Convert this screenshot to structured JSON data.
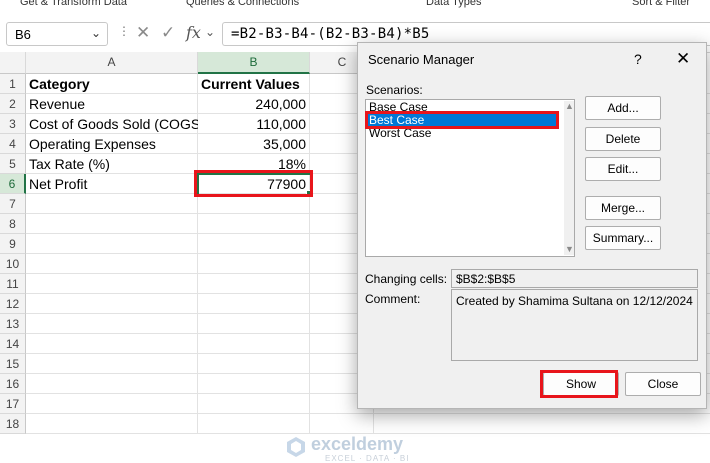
{
  "ribbon": {
    "groups": [
      "Get & Transform Data",
      "Queries & Connections",
      "Data Types",
      "Sort & Filter"
    ]
  },
  "formula_bar": {
    "name_box": "B6",
    "formula": "=B2-B3-B4-(B2-B3-B4)*B5"
  },
  "sheet": {
    "columns": [
      "A",
      "B",
      "C"
    ],
    "rows": [
      "1",
      "2",
      "3",
      "4",
      "5",
      "6",
      "7",
      "8",
      "9",
      "10",
      "11",
      "12",
      "13",
      "14",
      "15",
      "16",
      "17",
      "18"
    ],
    "cells": {
      "A1": "Category",
      "B1": "Current Values",
      "A2": "Revenue",
      "B2": "240,000",
      "A3": "Cost of Goods Sold (COGS)",
      "B3": "110,000",
      "A4": "Operating Expenses",
      "B4": "35,000",
      "A5": "Tax Rate (%)",
      "B5": "18%",
      "A6": "Net Profit",
      "B6": "77900"
    }
  },
  "dialog": {
    "title": "Scenario Manager",
    "help": "?",
    "close": "✕",
    "scenarios_label": "Scenarios:",
    "scenarios": [
      "Base Case",
      "Best Case",
      "Worst Case"
    ],
    "selected_scenario": "Best Case",
    "buttons": {
      "add": "Add...",
      "delete": "Delete",
      "edit": "Edit...",
      "merge": "Merge...",
      "summary": "Summary...",
      "show": "Show",
      "close": "Close"
    },
    "changing_cells_label": "Changing cells:",
    "changing_cells": "$B$2:$B$5",
    "comment_label": "Comment:",
    "comment": "Created by Shamima Sultana on 12/12/2024"
  },
  "watermark": {
    "name": "exceldemy",
    "tagline": "EXCEL · DATA · BI"
  },
  "colors": {
    "excel_green": "#217346",
    "highlight_red": "#e8151b",
    "selection_blue": "#0078d7"
  }
}
